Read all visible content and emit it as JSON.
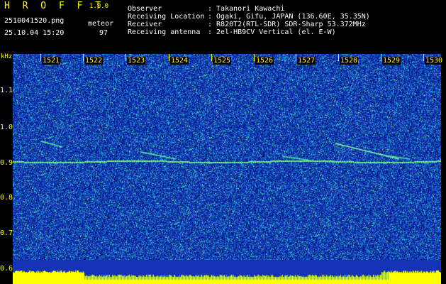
{
  "app": {
    "brand": "HROFFT",
    "version": "1.0.0"
  },
  "file": {
    "name": "2510041520.png",
    "datetime": "25.10.04 15:20",
    "mode": "meteor",
    "count": "97"
  },
  "info": {
    "labels": [
      "Observer",
      "Receiving Location",
      "Receiver",
      "Receiving antenna"
    ],
    "values": [
      ": Takanori Kawachi",
      ": Ogaki, Gifu, JAPAN (136.60E, 35.35N)",
      ": R820T2(RTL-SDR) SDR-Sharp 53.372MHz",
      ": 2el-HB9CV Vertical (el. E-W)"
    ]
  },
  "axis": {
    "unit": "kHz",
    "freq_ticks": [
      "1.1",
      "1.0",
      "0.9",
      "0.8",
      "0.7",
      "0.6"
    ],
    "time_ticks": [
      "1521",
      "1522",
      "1523",
      "1524",
      "1525",
      "1526",
      "1527",
      "1528",
      "1529",
      "1530"
    ]
  },
  "colors": {
    "label": "#ffff00",
    "text": "#ffffff",
    "background": "#000000",
    "waterfall": "#1533b4",
    "signal": "#00ff80"
  }
}
